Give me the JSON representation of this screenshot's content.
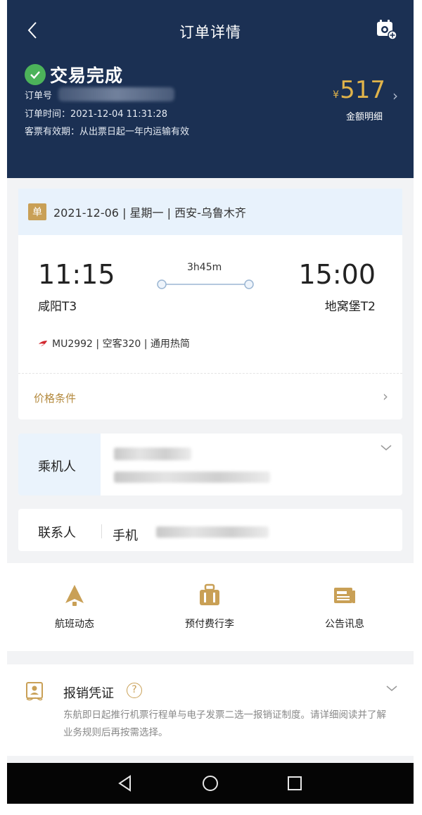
{
  "header": {
    "title": "订单详情",
    "status": "交易完成",
    "order_no_label": "订单号",
    "order_time": "订单时间：2021-12-04 11:31:28",
    "validity": "客票有效期：从出票日起一年内运输有效",
    "currency": "¥",
    "price": "517",
    "price_detail": "金额明细",
    "accent_color": "#e0b34a",
    "bg_color": "#1b3053"
  },
  "flight": {
    "tag": "单",
    "route": "2021-12-06 | 星期一 | 西安-乌鲁木齐",
    "dep_time": "11:15",
    "dep_airport": "咸阳T3",
    "arr_time": "15:00",
    "arr_airport": "地窝堡T2",
    "duration": "3h45m",
    "flight_info": "MU2992 | 空客320 | 通用热简",
    "price_conditions": "价格条件"
  },
  "passenger": {
    "label": "乘机人"
  },
  "contact": {
    "label": "联系人",
    "phone_label": "手机"
  },
  "services": [
    {
      "label": "航班动态",
      "icon": "flight-status-icon"
    },
    {
      "label": "预付费行李",
      "icon": "baggage-icon"
    },
    {
      "label": "公告讯息",
      "icon": "notice-icon"
    }
  ],
  "reimbursement": {
    "title": "报销凭证",
    "help": "?",
    "description": "东航即日起推行机票行程单与电子发票二选一报销证制度。请详细阅读并了解业务规则后再按需选择。"
  }
}
